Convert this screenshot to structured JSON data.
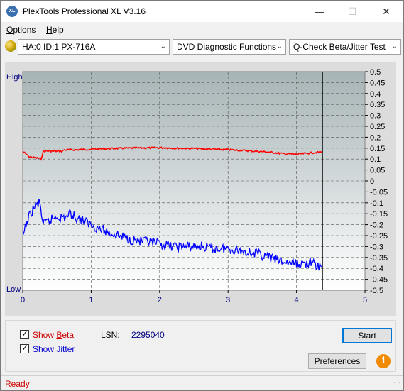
{
  "window": {
    "title": "PlexTools Professional XL V3.16",
    "icon_text": "XL",
    "minimize_icon": "minimize-icon",
    "maximize_icon": "maximize-icon",
    "close_icon": "close-icon"
  },
  "menu": [
    {
      "label": "Options",
      "mnemonic": "O"
    },
    {
      "label": "Help",
      "mnemonic": "H"
    }
  ],
  "toolbar": {
    "drive": "HA:0 ID:1  PX-716A",
    "function": "DVD Diagnostic Functions",
    "test": "Q-Check Beta/Jitter Test"
  },
  "chart_data": {
    "type": "line",
    "left_axis_labels": {
      "top": "High",
      "bottom": "Low"
    },
    "x_ticks": [
      "0",
      "1",
      "2",
      "3",
      "4",
      "5"
    ],
    "xlim": [
      0,
      5
    ],
    "y_ticks_right": [
      "0.5",
      "0.45",
      "0.4",
      "0.35",
      "0.3",
      "0.25",
      "0.2",
      "0.15",
      "0.1",
      "0.05",
      "0",
      "-0.05",
      "-0.1",
      "-0.15",
      "-0.2",
      "-0.25",
      "-0.3",
      "-0.35",
      "-0.4",
      "-0.45",
      "-0.5"
    ],
    "ylim": [
      -0.5,
      0.5
    ],
    "grid": true,
    "end_marker_x": 4.38,
    "series": [
      {
        "color": "#ff0000",
        "x": [
          0.0,
          0.1,
          0.2,
          0.27,
          0.3,
          0.35,
          0.5,
          0.58,
          0.6,
          0.8,
          1.0,
          1.2,
          1.5,
          2.0,
          2.5,
          3.0,
          3.3,
          3.6,
          3.8,
          4.0,
          4.2,
          4.38
        ],
        "y": [
          0.135,
          0.11,
          0.105,
          0.102,
          0.135,
          0.137,
          0.136,
          0.136,
          0.142,
          0.143,
          0.145,
          0.147,
          0.15,
          0.152,
          0.148,
          0.143,
          0.138,
          0.132,
          0.125,
          0.122,
          0.128,
          0.133
        ]
      },
      {
        "color": "#0000ff",
        "x": [
          0.0,
          0.05,
          0.1,
          0.15,
          0.2,
          0.25,
          0.3,
          0.4,
          0.5,
          0.6,
          0.7,
          0.8,
          1.0,
          1.2,
          1.4,
          1.6,
          1.8,
          2.0,
          2.2,
          2.4,
          2.6,
          2.8,
          3.0,
          3.2,
          3.4,
          3.6,
          3.8,
          4.0,
          4.1,
          4.2,
          4.3,
          4.38
        ],
        "y": [
          -0.26,
          -0.2,
          -0.16,
          -0.13,
          -0.11,
          -0.1,
          -0.2,
          -0.18,
          -0.16,
          -0.17,
          -0.15,
          -0.17,
          -0.2,
          -0.23,
          -0.25,
          -0.27,
          -0.28,
          -0.29,
          -0.3,
          -0.3,
          -0.3,
          -0.31,
          -0.31,
          -0.32,
          -0.33,
          -0.35,
          -0.37,
          -0.38,
          -0.38,
          -0.37,
          -0.39,
          -0.4
        ]
      }
    ]
  },
  "bottom": {
    "show_beta_label": "Show Beta",
    "show_beta_mnemonic": "B",
    "show_beta_checked": true,
    "show_jitter_label": "Show Jitter",
    "show_jitter_mnemonic": "J",
    "show_jitter_checked": true,
    "lsn_label": "LSN:",
    "lsn_value": "2295040",
    "start_label": "Start",
    "preferences_label": "Preferences",
    "info_icon": "info-icon"
  },
  "colors": {
    "beta": "#ff0000",
    "jitter": "#0000ff",
    "lsn_value": "#000080",
    "status": "#cc0000",
    "plot_top": "#a7b4b6",
    "plot_bottom": "#ffffff"
  },
  "status": {
    "text": "Ready"
  }
}
